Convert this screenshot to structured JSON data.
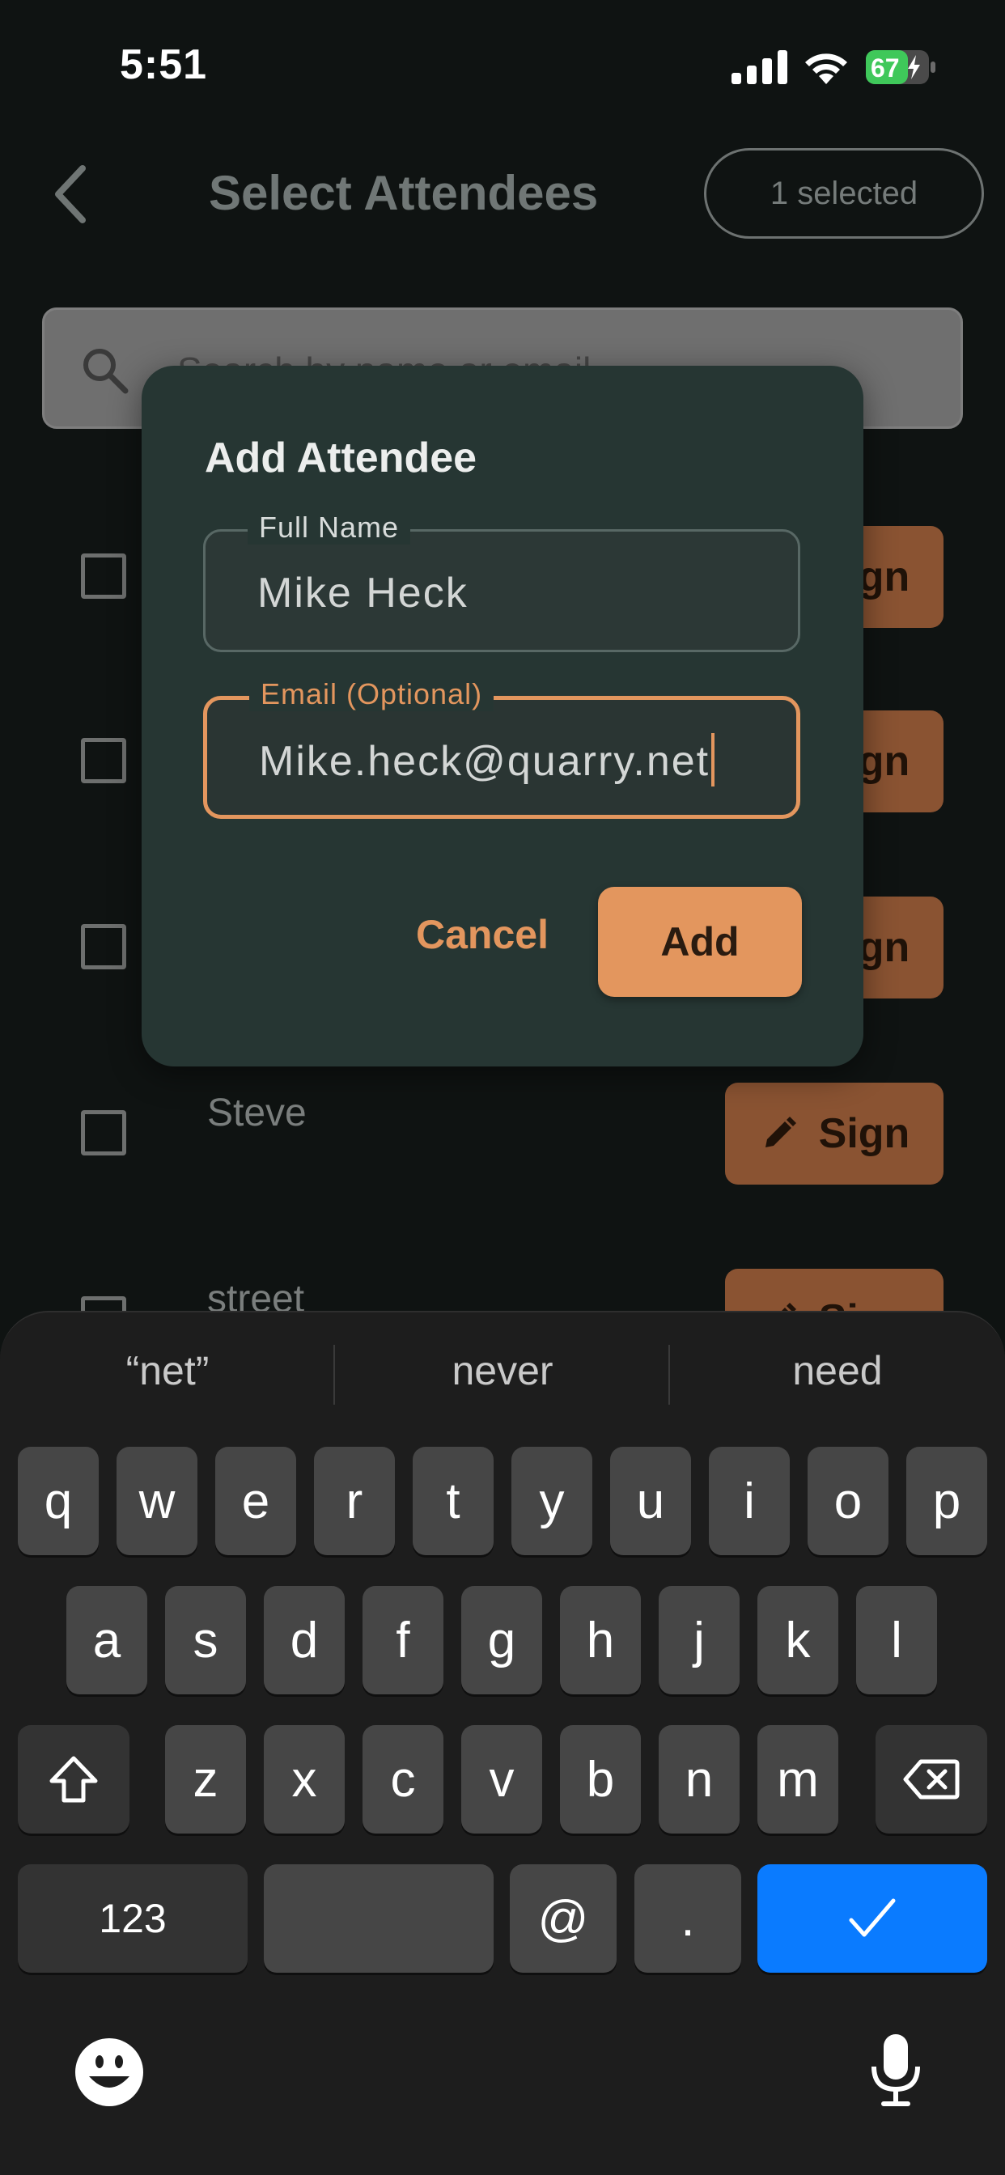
{
  "status_bar": {
    "time": "5:51",
    "battery": "67"
  },
  "header": {
    "title": "Select Attendees",
    "selected_badge": "1 selected"
  },
  "search": {
    "placeholder": "Search by name or email"
  },
  "attendee_list": [
    {
      "name": "",
      "button": "Sign"
    },
    {
      "name": "",
      "button": "Sign"
    },
    {
      "name": "",
      "button": "Sign"
    },
    {
      "name": "Steve",
      "button": "Sign"
    },
    {
      "name": "street",
      "button": "Sign"
    }
  ],
  "dialog": {
    "title": "Add Attendee",
    "full_name_label": "Full Name",
    "full_name_value": "Mike Heck",
    "email_label": "Email (Optional)",
    "email_value": "Mike.heck@quarry.net",
    "cancel_label": "Cancel",
    "add_label": "Add"
  },
  "keyboard": {
    "suggestions": [
      "“net”",
      "never",
      "need"
    ],
    "row1": [
      "q",
      "w",
      "e",
      "r",
      "t",
      "y",
      "u",
      "i",
      "o",
      "p"
    ],
    "row2": [
      "a",
      "s",
      "d",
      "f",
      "g",
      "h",
      "j",
      "k",
      "l"
    ],
    "row3": [
      "z",
      "x",
      "c",
      "v",
      "b",
      "n",
      "m"
    ],
    "numbers_label": "123",
    "at_label": "@",
    "dot_label": ".",
    "return_icon": "checkmark-icon",
    "emoji_icon": "emoji-icon",
    "mic_icon": "microphone-icon"
  },
  "colors": {
    "accent": "#e3965e",
    "dialog_bg": "#263633",
    "keyboard_blue": "#0a7bff"
  }
}
